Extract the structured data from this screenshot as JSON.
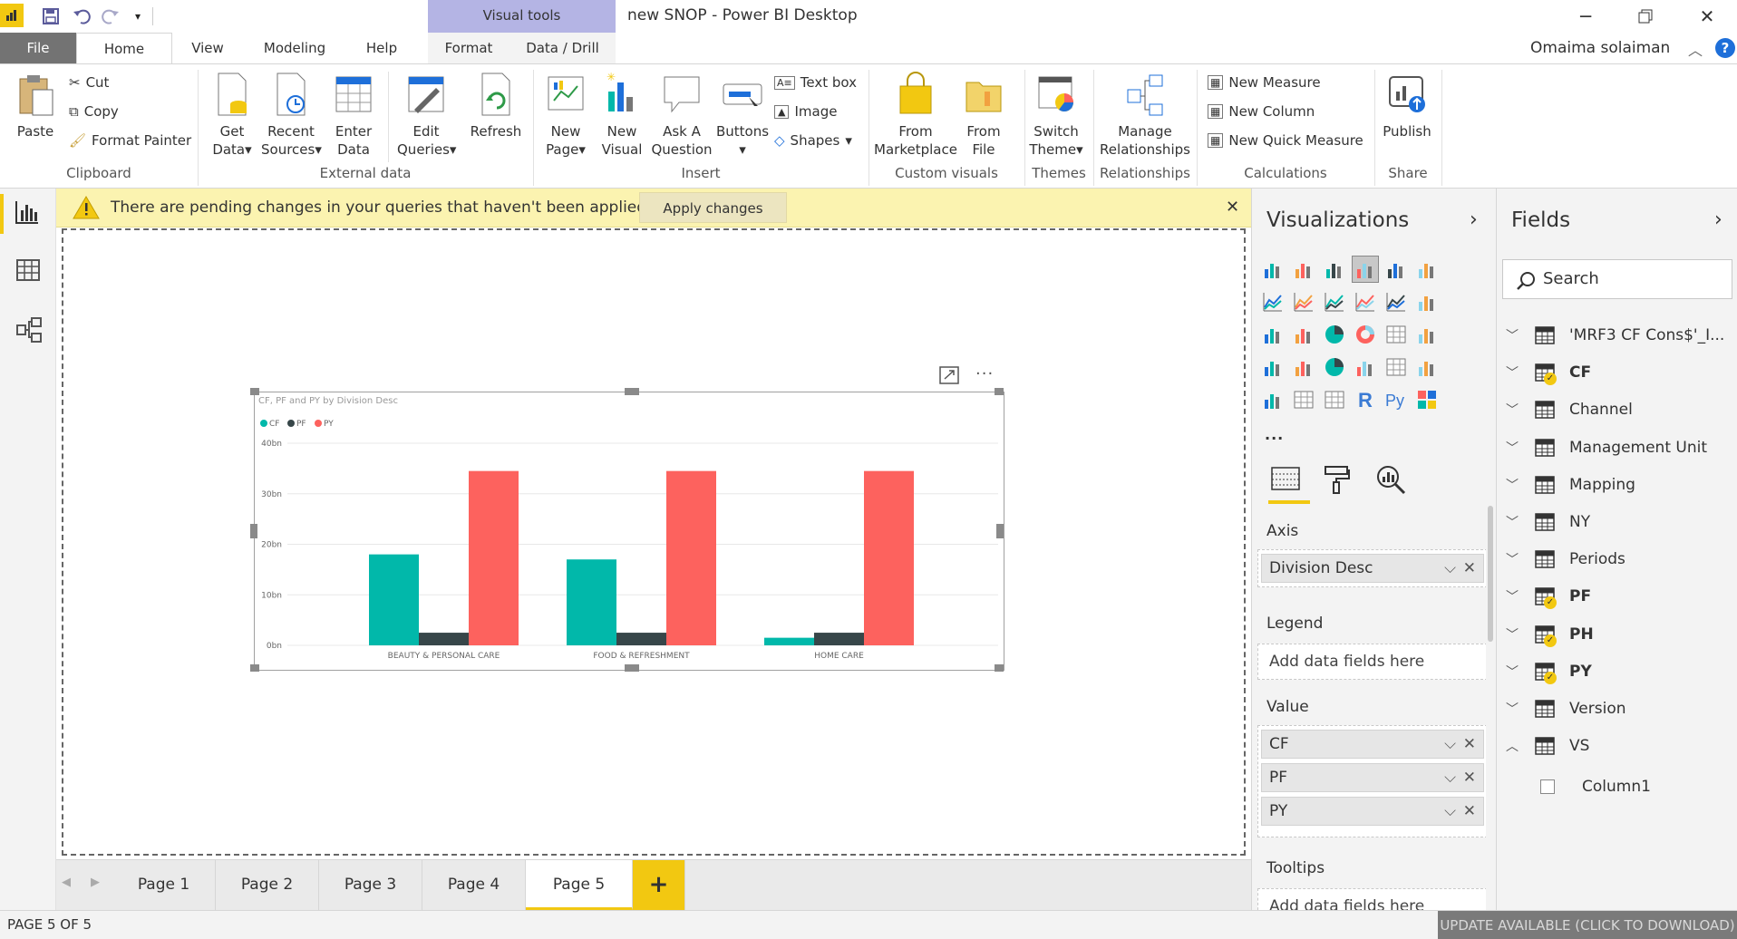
{
  "window": {
    "title": "new SNOP - Power BI Desktop",
    "contextual_tab_group": "Visual tools",
    "user": "Omaima solaiman"
  },
  "tabs": {
    "file": "File",
    "home": "Home",
    "view": "View",
    "modeling": "Modeling",
    "help": "Help",
    "format": "Format",
    "data_drill": "Data / Drill"
  },
  "ribbon": {
    "clipboard": {
      "paste": "Paste",
      "cut": "Cut",
      "copy": "Copy",
      "format_painter": "Format Painter",
      "label": "Clipboard"
    },
    "external_data": {
      "get_data": "Get Data",
      "recent_sources": "Recent Sources",
      "enter_data": "Enter Data",
      "edit_queries": "Edit Queries",
      "refresh": "Refresh",
      "label": "External data"
    },
    "insert": {
      "new_page": "New Page",
      "new_visual": "New Visual",
      "ask_question": "Ask A Question",
      "buttons": "Buttons",
      "text_box": "Text box",
      "image": "Image",
      "shapes": "Shapes",
      "label": "Insert"
    },
    "custom_visuals": {
      "from_marketplace": "From Marketplace",
      "from_file": "From File",
      "label": "Custom visuals"
    },
    "themes": {
      "switch_theme": "Switch Theme",
      "label": "Themes"
    },
    "relationships": {
      "manage": "Manage Relationships",
      "label": "Relationships"
    },
    "calculations": {
      "new_measure": "New Measure",
      "new_column": "New Column",
      "new_quick_measure": "New Quick Measure",
      "label": "Calculations"
    },
    "share": {
      "publish": "Publish",
      "label": "Share"
    }
  },
  "banner": {
    "message": "There are pending changes in your queries that haven't been applied.",
    "apply_button": "Apply changes"
  },
  "chart_data": {
    "type": "bar",
    "title": "CF, PF and PY by Division Desc",
    "categories": [
      "BEAUTY & PERSONAL CARE",
      "FOOD & REFRESHMENT",
      "HOME CARE"
    ],
    "series": [
      {
        "name": "CF",
        "color": "#01b8aa",
        "values": [
          18,
          17,
          1.5
        ]
      },
      {
        "name": "PF",
        "color": "#374649",
        "values": [
          2.5,
          2.5,
          2.5
        ]
      },
      {
        "name": "PY",
        "color": "#fd625e",
        "values": [
          34.5,
          34.5,
          34.5
        ]
      }
    ],
    "y_ticks": [
      "0bn",
      "10bn",
      "20bn",
      "30bn",
      "40bn"
    ],
    "ylim": [
      0,
      40
    ],
    "grid": true,
    "legend_position": "top-left"
  },
  "pages": {
    "tabs": [
      "Page 1",
      "Page 2",
      "Page 3",
      "Page 4",
      "Page 5"
    ],
    "active": "Page 5",
    "add": "+"
  },
  "status": {
    "page_indicator": "PAGE 5 OF 5",
    "update": "UPDATE AVAILABLE (CLICK TO DOWNLOAD)"
  },
  "visualizations": {
    "title": "Visualizations",
    "more": "...",
    "wells": {
      "axis": {
        "label": "Axis",
        "fields": [
          "Division Desc"
        ]
      },
      "legend": {
        "label": "Legend",
        "placeholder": "Add data fields here"
      },
      "value": {
        "label": "Value",
        "fields": [
          "CF",
          "PF",
          "PY"
        ]
      },
      "tooltips": {
        "label": "Tooltips",
        "placeholder": "Add data fields here"
      }
    }
  },
  "fields": {
    "title": "Fields",
    "search_placeholder": "Search",
    "tables": [
      {
        "name": "'MRF3 CF Cons$'_I...",
        "expanded": false,
        "checked": false
      },
      {
        "name": "CF",
        "expanded": false,
        "checked": true
      },
      {
        "name": "Channel",
        "expanded": false,
        "checked": false
      },
      {
        "name": "Management Unit",
        "expanded": false,
        "checked": false
      },
      {
        "name": "Mapping",
        "expanded": false,
        "checked": false
      },
      {
        "name": "NY",
        "expanded": false,
        "checked": false
      },
      {
        "name": "Periods",
        "expanded": false,
        "checked": false
      },
      {
        "name": "PF",
        "expanded": false,
        "checked": true
      },
      {
        "name": "PH",
        "expanded": false,
        "checked": true
      },
      {
        "name": "PY",
        "expanded": false,
        "checked": true
      },
      {
        "name": "Version",
        "expanded": false,
        "checked": false
      },
      {
        "name": "VS",
        "expanded": true,
        "checked": false
      }
    ],
    "vs_column": "Column1"
  }
}
